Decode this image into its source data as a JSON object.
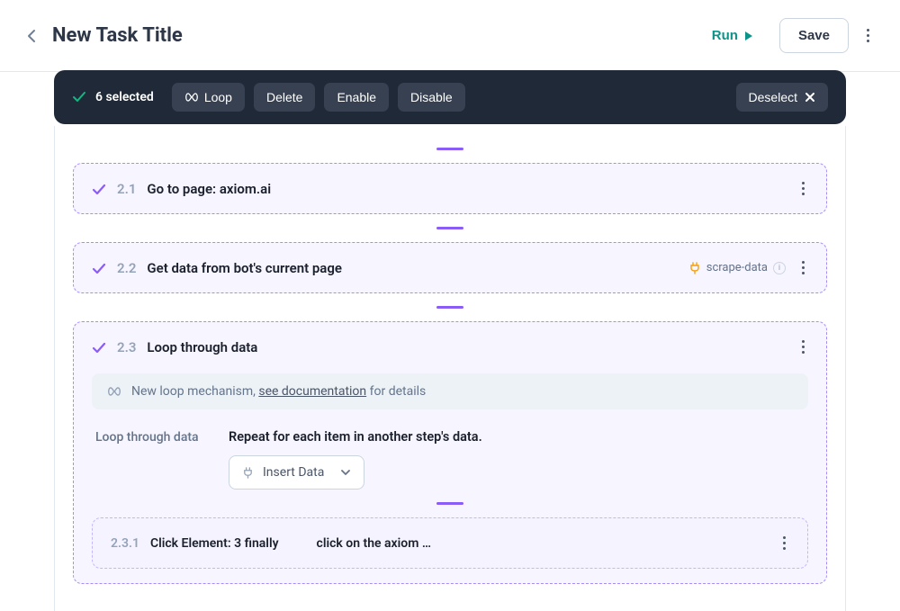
{
  "header": {
    "title": "New Task Title",
    "run_label": "Run",
    "save_label": "Save"
  },
  "selection": {
    "count_label": "6 selected",
    "loop_label": "Loop",
    "delete_label": "Delete",
    "enable_label": "Enable",
    "disable_label": "Disable",
    "deselect_label": "Deselect"
  },
  "steps": {
    "s21": {
      "num": "2.1",
      "title": "Go to page: axiom.ai"
    },
    "s22": {
      "num": "2.2",
      "title": "Get data from bot's current page",
      "tag": "scrape-data"
    },
    "s23": {
      "num": "2.3",
      "title": "Loop through data",
      "info_pre": "New loop mechanism, ",
      "info_link": "see documentation",
      "info_post": " for details",
      "param_label": "Loop through data",
      "param_desc": "Repeat for each item in another step's data.",
      "dropdown_label": "Insert Data",
      "sub": {
        "num": "2.3.1",
        "title": "Click Element: 3 finally",
        "desc": "click on the axiom …"
      }
    }
  }
}
